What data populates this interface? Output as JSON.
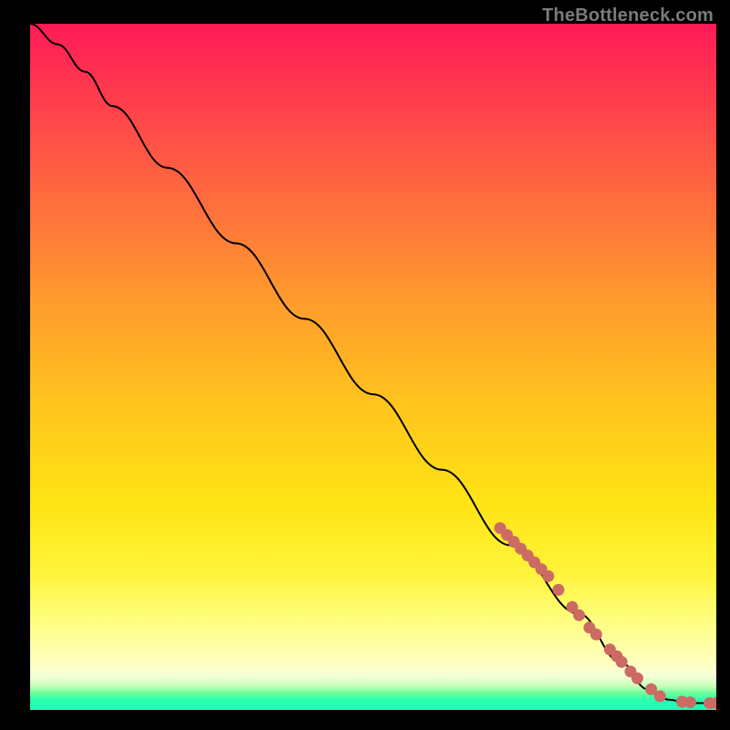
{
  "watermark": "TheBottleneck.com",
  "colors": {
    "dot": "#cc6b63",
    "curve": "#000000",
    "gradient_stops": [
      "#ff1a56",
      "#ff3a4e",
      "#ff6a3e",
      "#ff9a2e",
      "#ffc31e",
      "#ffe414",
      "#fff43a",
      "#ffff8a",
      "#ffffc0",
      "#f7ffd8",
      "#c8ffb8",
      "#6eff9a",
      "#2effb0",
      "#16ffb8"
    ]
  },
  "chart_data": {
    "type": "line",
    "title": "",
    "xlabel": "",
    "ylabel": "",
    "xlim": [
      0,
      100
    ],
    "ylim": [
      0,
      100
    ],
    "grid": false,
    "legend": false,
    "series": [
      {
        "name": "curve",
        "kind": "line",
        "color": "#000000",
        "points": [
          {
            "x": 0,
            "y": 100
          },
          {
            "x": 4,
            "y": 97
          },
          {
            "x": 8,
            "y": 93
          },
          {
            "x": 12,
            "y": 88
          },
          {
            "x": 20,
            "y": 79
          },
          {
            "x": 30,
            "y": 68
          },
          {
            "x": 40,
            "y": 57
          },
          {
            "x": 50,
            "y": 46
          },
          {
            "x": 60,
            "y": 35
          },
          {
            "x": 70,
            "y": 24
          },
          {
            "x": 80,
            "y": 14
          },
          {
            "x": 86,
            "y": 7
          },
          {
            "x": 90,
            "y": 3
          },
          {
            "x": 93,
            "y": 1.5
          },
          {
            "x": 96,
            "y": 1
          },
          {
            "x": 100,
            "y": 1
          }
        ]
      },
      {
        "name": "dots",
        "kind": "scatter",
        "color": "#cc6b63",
        "radius": 6,
        "points": [
          {
            "x": 68.5,
            "y": 26.5
          },
          {
            "x": 69.5,
            "y": 25.5
          },
          {
            "x": 70.5,
            "y": 24.5
          },
          {
            "x": 71.5,
            "y": 23.5
          },
          {
            "x": 72.5,
            "y": 22.5
          },
          {
            "x": 73.5,
            "y": 21.5
          },
          {
            "x": 74.5,
            "y": 20.5
          },
          {
            "x": 75.5,
            "y": 19.5
          },
          {
            "x": 77.0,
            "y": 17.5
          },
          {
            "x": 79.0,
            "y": 15.0
          },
          {
            "x": 80.0,
            "y": 13.8
          },
          {
            "x": 81.5,
            "y": 12.0
          },
          {
            "x": 82.5,
            "y": 11.0
          },
          {
            "x": 84.5,
            "y": 8.8
          },
          {
            "x": 85.5,
            "y": 7.8
          },
          {
            "x": 86.2,
            "y": 7.0
          },
          {
            "x": 87.5,
            "y": 5.6
          },
          {
            "x": 88.5,
            "y": 4.6
          },
          {
            "x": 90.5,
            "y": 3.0
          },
          {
            "x": 91.8,
            "y": 2.0
          },
          {
            "x": 95.0,
            "y": 1.2
          },
          {
            "x": 96.2,
            "y": 1.1
          },
          {
            "x": 99.0,
            "y": 1.0
          },
          {
            "x": 100.0,
            "y": 1.0
          }
        ]
      }
    ]
  }
}
